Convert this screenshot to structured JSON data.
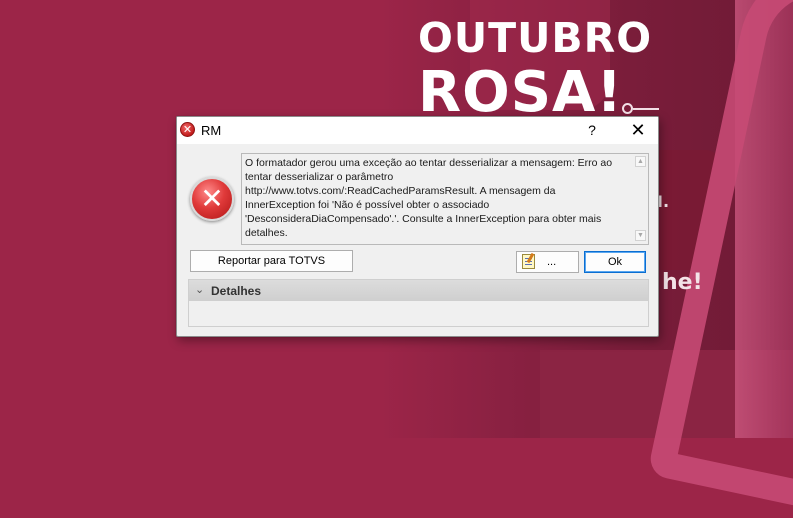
{
  "background": {
    "title_line1": "OUTUBRO",
    "title_line2": "ROSA!",
    "fragment1": "he!",
    "fragment2": "I.",
    "colors": {
      "base": "#9c2548",
      "ribbon": "#c64a74"
    }
  },
  "dialog": {
    "title": "RM",
    "title_icon": "error-icon",
    "help_label": "?",
    "close_label": "✕",
    "message": "O formatador gerou uma exceção ao tentar desserializar a mensagem: Erro ao\ntentar desserializar o parâmetro\nhttp://www.totvs.com/:ReadCachedParamsResult. A mensagem da\nInnerException foi 'Não é possível obter o associado\n'DesconsideraDiaCompensado'.'. Consulte a InnerException para obter mais\ndetalhes.",
    "scroll_up": "▲",
    "scroll_down": "▼",
    "report_button": "Reportar para TOTVS",
    "more_button": "...",
    "ok_button": "Ok",
    "details_chevron": "⌄",
    "details_label": "Detalhes",
    "big_icon_glyph": "✕",
    "title_icon_glyph": "✕"
  }
}
